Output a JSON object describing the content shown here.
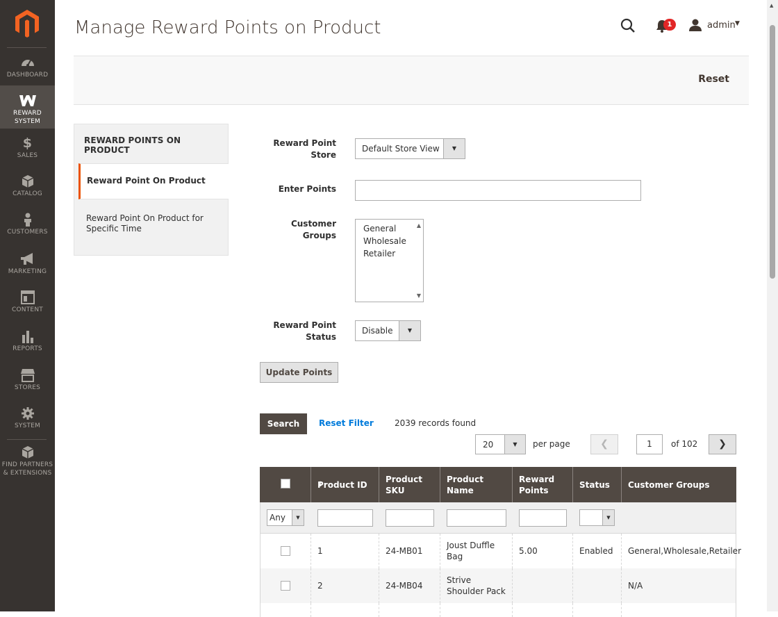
{
  "sidebar": {
    "items": [
      {
        "label": "DASHBOARD",
        "icon": "dashboard-icon"
      },
      {
        "label": "REWARD SYSTEM",
        "icon": "reward-icon",
        "active": true
      },
      {
        "label": "SALES",
        "icon": "dollar-icon"
      },
      {
        "label": "CATALOG",
        "icon": "cube-icon"
      },
      {
        "label": "CUSTOMERS",
        "icon": "person-icon"
      },
      {
        "label": "MARKETING",
        "icon": "megaphone-icon"
      },
      {
        "label": "CONTENT",
        "icon": "content-icon"
      },
      {
        "label": "REPORTS",
        "icon": "bar-chart-icon"
      },
      {
        "label": "STORES",
        "icon": "store-icon"
      },
      {
        "label": "SYSTEM",
        "icon": "gear-icon"
      },
      {
        "label": "FIND PARTNERS & EXTENSIONS",
        "icon": "box-icon"
      }
    ]
  },
  "header": {
    "title": "Manage Reward Points on Product",
    "notification_count": "1",
    "user": "admin"
  },
  "actions": {
    "reset_label": "Reset"
  },
  "tabs": {
    "title": "REWARD POINTS ON PRODUCT",
    "active": "Reward Point On Product",
    "inactive": "Reward Point On Product for Specific Time"
  },
  "form": {
    "store_label": "Reward Point Store",
    "store_value": "Default Store View",
    "points_label": "Enter Points",
    "points_value": "",
    "groups_label": "Customer Groups",
    "groups_options": [
      "General",
      "Wholesale",
      "Retailer"
    ],
    "status_label": "Reward Point Status",
    "status_value": "Disable",
    "update_label": "Update Points"
  },
  "grid_toolbar": {
    "search_label": "Search",
    "reset_filter_label": "Reset Filter",
    "records": "2039 records found",
    "per_page_value": "20",
    "per_page_label": "per page",
    "current_page": "1",
    "total_pages": "of 102"
  },
  "grid": {
    "columns": [
      "Product ID",
      "Product SKU",
      "Product Name",
      "Reward Points",
      "Status",
      "Customer Groups"
    ],
    "filter_any": "Any",
    "rows": [
      {
        "id": "1",
        "sku": "24-MB01",
        "name": "Joust Duffle Bag",
        "points": "5.00",
        "status": "Enabled",
        "groups": "General,Wholesale,Retailer"
      },
      {
        "id": "2",
        "sku": "24-MB04",
        "name": "Strive Shoulder Pack",
        "points": "",
        "status": "",
        "groups": "N/A"
      }
    ]
  },
  "colors": {
    "sidebar_bg": "#373330",
    "accent": "#eb5202",
    "grid_header": "#514943",
    "link": "#007bdb"
  }
}
